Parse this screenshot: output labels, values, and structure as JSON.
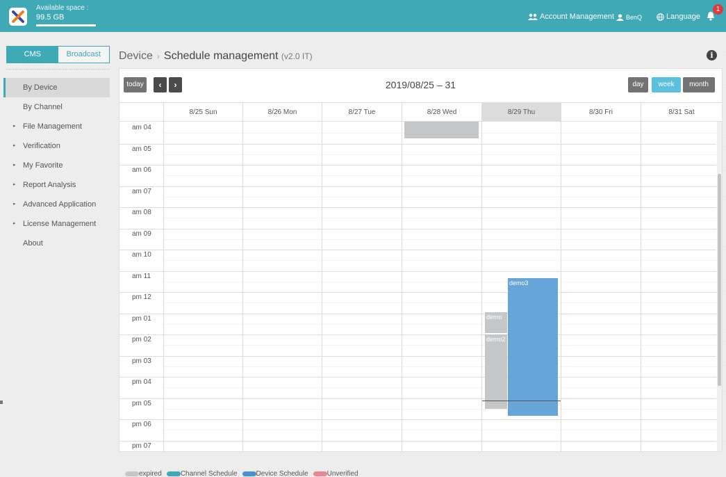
{
  "app": {
    "logo_icon": "app-logo-icon",
    "space_label": "Available space :",
    "space_value": "99.5 GB",
    "space_used_fraction": 1.0
  },
  "topbar": {
    "account_label": "Account Management",
    "user_label": "BenQ",
    "language_label": "Language",
    "notification_count": "1",
    "icons": [
      "users-icon",
      "user-icon",
      "globe-icon",
      "bell-icon"
    ]
  },
  "sidebar": {
    "tabs": [
      {
        "label": "CMS",
        "active": true
      },
      {
        "label": "Broadcast",
        "active": false
      }
    ],
    "items": [
      {
        "label": "By Device",
        "active": true,
        "expandable": false
      },
      {
        "label": "By Channel",
        "active": false,
        "expandable": false
      },
      {
        "label": "File Management",
        "active": false,
        "expandable": true
      },
      {
        "label": "Verification",
        "active": false,
        "expandable": true
      },
      {
        "label": "My Favorite",
        "active": false,
        "expandable": true
      },
      {
        "label": "Report Analysis",
        "active": false,
        "expandable": true
      },
      {
        "label": "Advanced Application",
        "active": false,
        "expandable": true
      },
      {
        "label": "License Management",
        "active": false,
        "expandable": true
      },
      {
        "label": "About",
        "active": false,
        "expandable": false
      }
    ]
  },
  "breadcrumb": {
    "parent": "Device",
    "separator": "›",
    "current": "Schedule management",
    "version": "(v2.0 IT)"
  },
  "calendar": {
    "today_label": "today",
    "prev_icon": "‹",
    "next_icon": "›",
    "range_title": "2019/08/25 – 31",
    "views": [
      {
        "label": "day",
        "active": false
      },
      {
        "label": "week",
        "active": true
      },
      {
        "label": "month",
        "active": false
      }
    ],
    "days": [
      "8/25 Sun",
      "8/26 Mon",
      "8/27 Tue",
      "8/28 Wed",
      "8/29 Thu",
      "8/30 Fri",
      "8/31 Sat"
    ],
    "today_index": 4,
    "hours": [
      "am 04",
      "am 05",
      "am 06",
      "am 07",
      "am 08",
      "am 09",
      "am 10",
      "am 11",
      "pm 12",
      "pm 01",
      "pm 02",
      "pm 03",
      "pm 04",
      "pm 05",
      "pm 06",
      "pm 07"
    ],
    "events": [
      {
        "day": 3,
        "start": 3.0,
        "end": 4.75,
        "type": "expired",
        "label": "",
        "lane": 0,
        "lanes": 1
      },
      {
        "day": 4,
        "start": 11.33,
        "end": 17.83,
        "type": "device",
        "label": "demo3",
        "lane": 1,
        "lanes": 2
      },
      {
        "day": 4,
        "start": 12.95,
        "end": 13.95,
        "type": "expired",
        "label": "demo",
        "lane": 0,
        "lanes": 2
      },
      {
        "day": 4,
        "start": 14.0,
        "end": 17.5,
        "type": "expired",
        "label": "demo2",
        "lane": 0,
        "lanes": 2
      }
    ],
    "now_time": 17.1
  },
  "legend": [
    {
      "label": "expired",
      "color": "#c4c6c8"
    },
    {
      "label": "Channel Schedule",
      "color": "#3fa9b5"
    },
    {
      "label": "Device Schedule",
      "color": "#4a90d0"
    },
    {
      "label": "Unverified",
      "color": "#e88a8f"
    }
  ]
}
